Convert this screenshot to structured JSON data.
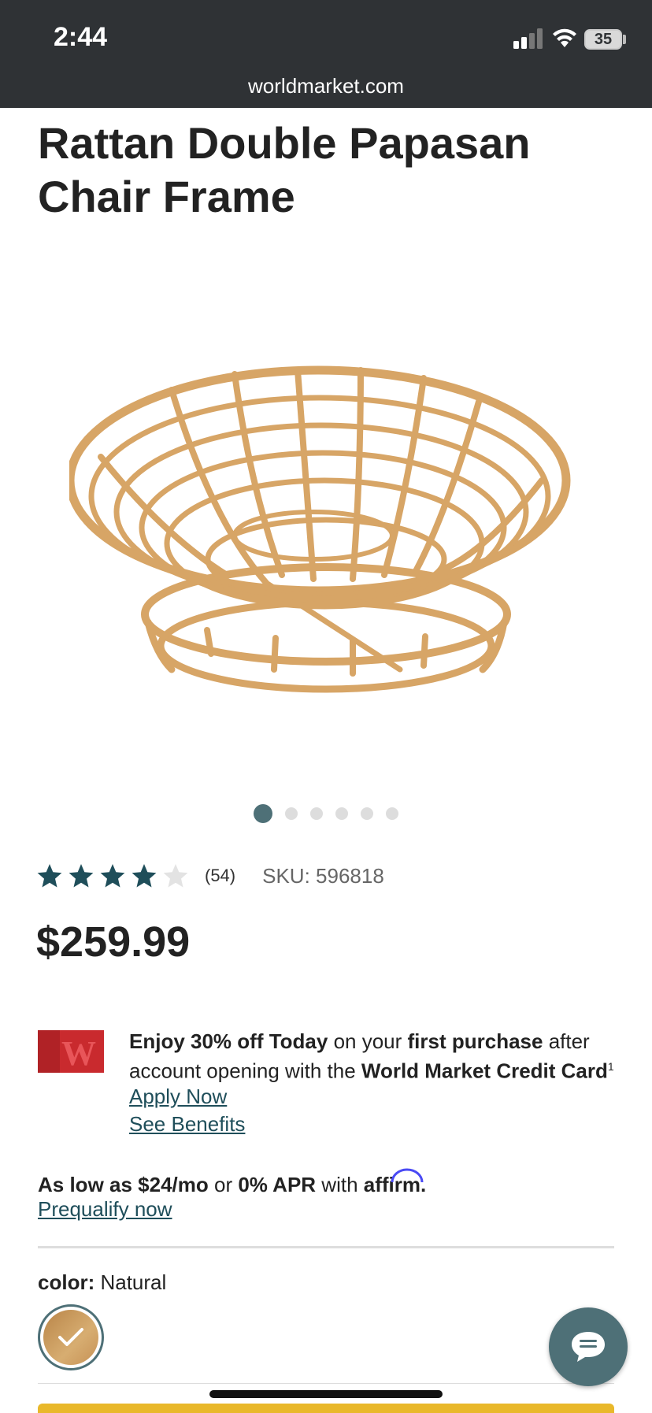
{
  "status_bar": {
    "time": "2:44",
    "battery": "35"
  },
  "browser": {
    "url": "worldmarket.com"
  },
  "product": {
    "title": "Rattan Double Papasan Chair Frame",
    "image_alt": "rattan-papasan-frame",
    "gallery_total": 6,
    "gallery_active": 1,
    "rating": 4,
    "rating_max": 5,
    "review_count": "(54)",
    "sku": "SKU: 596818",
    "price": "$259.99"
  },
  "promo": {
    "logo_letter": "W",
    "part1_bold": "Enjoy 30% off Today",
    "part2": " on your ",
    "part3_bold": "first purchase",
    "part4": " after account opening with the ",
    "part5_bold": "World Market Credit Card",
    "footnote": "1",
    "apply_link": "Apply Now",
    "benefits_link": "See Benefits"
  },
  "financing": {
    "bold1": "As low as $24/mo",
    "text2": " or ",
    "bold3": "0% APR",
    "text4": " with ",
    "affirm": "affirm",
    "period": ".",
    "prequalify_link": "Prequalify now"
  },
  "color_selector": {
    "label": "color:",
    "value": "Natural"
  },
  "colors": {
    "accent": "#4e7077",
    "link": "#1f4e5a",
    "status_bar": "#2f3235",
    "cta": "#e9b82a"
  }
}
